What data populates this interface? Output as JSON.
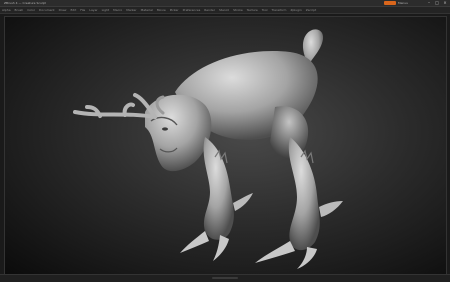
{
  "window": {
    "title": "ZBrush 4 — Creature Sculpt",
    "tag_label": "Menus",
    "controls": [
      "–",
      "□",
      "×"
    ]
  },
  "menubar": {
    "items": [
      "Alpha",
      "Brush",
      "Color",
      "Document",
      "Draw",
      "Edit",
      "File",
      "Layer",
      "Light",
      "Macro",
      "Marker",
      "Material",
      "Movie",
      "Picker",
      "Preferences",
      "Render",
      "Stencil",
      "Stroke",
      "Texture",
      "Tool",
      "Transform",
      "Zplugin",
      "Zscript"
    ]
  },
  "canvas": {
    "subject": "sculpted creature",
    "colors": {
      "clay": "#b8b8b8",
      "background_center": "#4a4a4a",
      "background_edge": "#0b0b0b",
      "accent": "#d9661c"
    }
  }
}
